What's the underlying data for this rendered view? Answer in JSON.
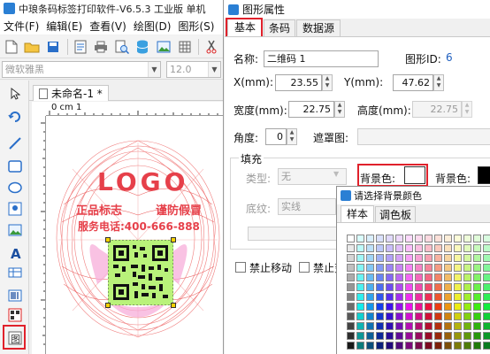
{
  "main_window": {
    "title": "中琅条码标签打印软件-V6.5.3 工业版 单机",
    "menu": [
      {
        "label": "文件(F)"
      },
      {
        "label": "编辑(E)"
      },
      {
        "label": "查看(V)"
      },
      {
        "label": "绘图(D)"
      },
      {
        "label": "图形(S)"
      }
    ],
    "toolbar_icons": [
      "new-file-icon",
      "open-folder-icon",
      "save-icon",
      "page-setup-icon",
      "print-icon",
      "print-preview-icon",
      "database-icon",
      "image-icon",
      "grid-icon",
      "cut-icon"
    ],
    "font_name": "微软雅黑",
    "font_size": "12.0",
    "left_tools": [
      "select-arrow-icon",
      "rotate-icon",
      "line-icon",
      "rectangle-icon",
      "ellipse-icon",
      "barcode-image-icon",
      "picture-icon",
      "text-a-icon",
      "table-icon",
      "barcode-icon",
      "qrcode-icon",
      "shape-icon",
      "rfid-icon"
    ],
    "document_tab": "未命名-1 *",
    "ruler": {
      "top_label": "0 cm 1",
      "ticks": [
        "0",
        "1"
      ]
    },
    "canvas": {
      "logo_text": "LOGO",
      "line1": "正品标志",
      "line2": "谨防假冒",
      "phone_line": "服务电话:400-666-888"
    }
  },
  "properties_dialog": {
    "title": "图形属性",
    "tabs": [
      "基本",
      "条码",
      "数据源"
    ],
    "active_tab": "基本",
    "name_label": "名称:",
    "name_value": "二维码 1",
    "id_label": "图形ID:",
    "id_value": "6",
    "x_label": "X(mm):",
    "x_value": "23.55",
    "y_label": "Y(mm):",
    "y_value": "47.62",
    "width_label": "宽度(mm):",
    "width_value": "22.75",
    "height_label": "高度(mm):",
    "height_value": "22.75",
    "angle_label": "角度:",
    "angle_value": "0",
    "mask_label": "遮罩图:",
    "fill_group_label": "填充",
    "type_label": "类型:",
    "type_value": "无",
    "bg_color_label": "背景色:",
    "bg_color_label2": "背景色:",
    "texture_label": "底纹:",
    "texture_value": "实线",
    "lock_move_label": "禁止移动",
    "lock_other_label": "禁止变",
    "colors": {
      "bg_swatch": "#ffffff",
      "bg_swatch2": "#000000",
      "highlight": "#e0212b"
    }
  },
  "color_picker": {
    "title": "请选择背景颜色",
    "tabs": [
      "样本",
      "调色板"
    ],
    "active_tab": "样本"
  }
}
